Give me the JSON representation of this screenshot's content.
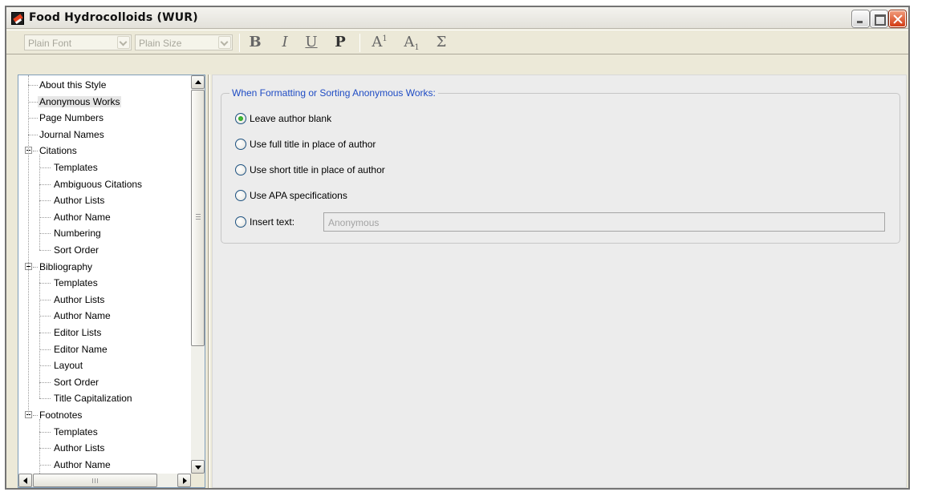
{
  "window": {
    "title": "Food Hydrocolloids (WUR)",
    "controls": [
      "minimize",
      "maximize",
      "close"
    ]
  },
  "toolbar": {
    "font_value": "Plain Font",
    "size_value": "Plain Size",
    "bold": "B",
    "italic": "I",
    "underline": "U",
    "plain": "P",
    "superscript_base": "A",
    "superscript_mark": "1",
    "subscript_base": "A",
    "subscript_mark": "1",
    "sigma": "Σ"
  },
  "tree": {
    "selected": "Anonymous Works",
    "items": [
      {
        "label": "About this Style",
        "level": 0
      },
      {
        "label": "Anonymous Works",
        "level": 0
      },
      {
        "label": "Page Numbers",
        "level": 0
      },
      {
        "label": "Journal Names",
        "level": 0
      },
      {
        "label": "Citations",
        "level": 0,
        "expanded": true
      },
      {
        "label": "Templates",
        "level": 1
      },
      {
        "label": "Ambiguous Citations",
        "level": 1
      },
      {
        "label": "Author Lists",
        "level": 1
      },
      {
        "label": "Author Name",
        "level": 1
      },
      {
        "label": "Numbering",
        "level": 1
      },
      {
        "label": "Sort Order",
        "level": 1
      },
      {
        "label": "Bibliography",
        "level": 0,
        "expanded": true
      },
      {
        "label": "Templates",
        "level": 1
      },
      {
        "label": "Author Lists",
        "level": 1
      },
      {
        "label": "Author Name",
        "level": 1
      },
      {
        "label": "Editor Lists",
        "level": 1
      },
      {
        "label": "Editor Name",
        "level": 1
      },
      {
        "label": "Layout",
        "level": 1
      },
      {
        "label": "Sort Order",
        "level": 1
      },
      {
        "label": "Title Capitalization",
        "level": 1
      },
      {
        "label": "Footnotes",
        "level": 0,
        "expanded": true
      },
      {
        "label": "Templates",
        "level": 1
      },
      {
        "label": "Author Lists",
        "level": 1
      },
      {
        "label": "Author Name",
        "level": 1
      }
    ]
  },
  "anonymous_works": {
    "group_title": "When Formatting or Sorting Anonymous Works:",
    "options": [
      {
        "label": "Leave author blank",
        "checked": true
      },
      {
        "label": "Use full title in place of author",
        "checked": false
      },
      {
        "label": "Use short title in place of author",
        "checked": false
      },
      {
        "label": "Use APA specifications",
        "checked": false
      },
      {
        "label": "Insert text:",
        "checked": false
      }
    ],
    "insert_text_value": "Anonymous"
  },
  "colors": {
    "group_title": "#1f4cc4",
    "radio_checked": "#2aa321",
    "close_button": "#d23c14"
  }
}
